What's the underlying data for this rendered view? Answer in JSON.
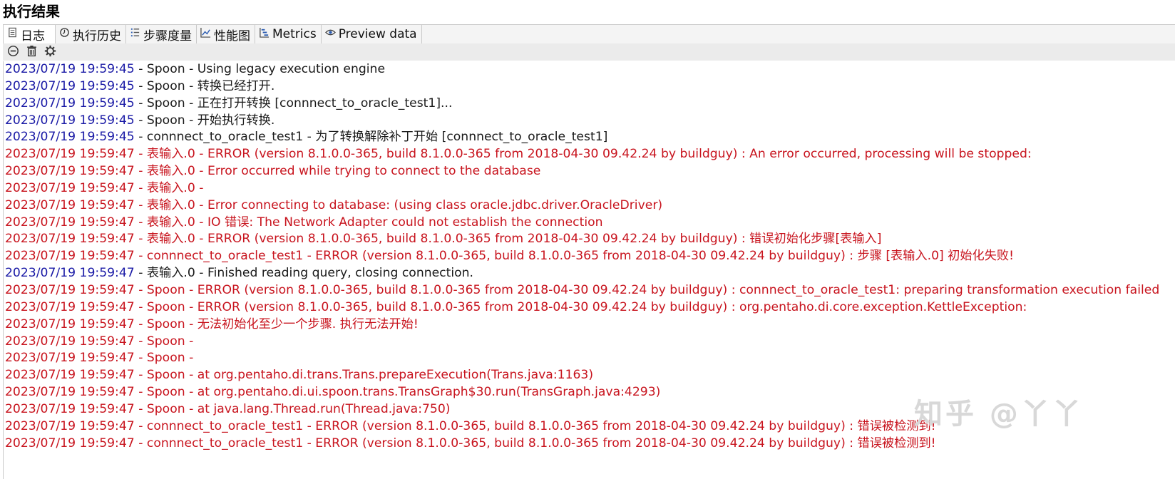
{
  "panel": {
    "title": "执行结果"
  },
  "tabs": [
    {
      "label": "日志",
      "icon": "log-icon",
      "active": true
    },
    {
      "label": "执行历史",
      "icon": "history-icon"
    },
    {
      "label": "步骤度量",
      "icon": "step-metrics-icon"
    },
    {
      "label": "性能图",
      "icon": "performance-chart-icon"
    },
    {
      "label": "Metrics",
      "icon": "metrics-icon"
    },
    {
      "label": "Preview data",
      "icon": "preview-eye-icon"
    }
  ],
  "toolbar": {
    "buttons": [
      {
        "icon": "stop-circle-icon"
      },
      {
        "icon": "trash-icon"
      },
      {
        "icon": "settings-gear-icon"
      }
    ]
  },
  "colors": {
    "timestamp": "#1a1aa6",
    "error": "#c8141e",
    "text": "#1a1a1a"
  },
  "log": [
    {
      "ts": "2023/07/19 19:59:45",
      "msg": " - Spoon - Using legacy execution engine",
      "error": false
    },
    {
      "ts": "2023/07/19 19:59:45",
      "msg": " - Spoon - 转换已经打开.",
      "error": false
    },
    {
      "ts": "2023/07/19 19:59:45",
      "msg": " - Spoon - 正在打开转换 [connnect_to_oracle_test1]...",
      "error": false
    },
    {
      "ts": "2023/07/19 19:59:45",
      "msg": " - Spoon - 开始执行转换.",
      "error": false
    },
    {
      "ts": "2023/07/19 19:59:45",
      "msg": " - connnect_to_oracle_test1 - 为了转换解除补丁开始  [connnect_to_oracle_test1]",
      "error": false
    },
    {
      "ts": "2023/07/19 19:59:47",
      "msg": " - 表输入.0 - ERROR (version 8.1.0.0-365, build 8.1.0.0-365 from 2018-04-30 09.42.24 by buildguy) : An error occurred, processing will be stopped:",
      "error": true
    },
    {
      "ts": "2023/07/19 19:59:47",
      "msg": " - 表输入.0 - Error occurred while trying to connect to the database",
      "error": true
    },
    {
      "ts": "2023/07/19 19:59:47",
      "msg": " - 表输入.0 - ",
      "error": true
    },
    {
      "ts": "2023/07/19 19:59:47",
      "msg": " - 表输入.0 - Error connecting to database: (using class oracle.jdbc.driver.OracleDriver)",
      "error": true
    },
    {
      "ts": "2023/07/19 19:59:47",
      "msg": " - 表输入.0 - IO 错误: The Network Adapter could not establish the connection",
      "error": true
    },
    {
      "ts": "2023/07/19 19:59:47",
      "msg": " - 表输入.0 - ERROR (version 8.1.0.0-365, build 8.1.0.0-365 from 2018-04-30 09.42.24 by buildguy) : 错误初始化步骤[表输入]",
      "error": true
    },
    {
      "ts": "2023/07/19 19:59:47",
      "msg": " - connnect_to_oracle_test1 - ERROR (version 8.1.0.0-365, build 8.1.0.0-365 from 2018-04-30 09.42.24 by buildguy) : 步骤 [表输入.0] 初始化失败!",
      "error": true
    },
    {
      "ts": "2023/07/19 19:59:47",
      "msg": " - 表输入.0 - Finished reading query, closing connection.",
      "error": false
    },
    {
      "ts": "2023/07/19 19:59:47",
      "msg": " - Spoon - ERROR (version 8.1.0.0-365, build 8.1.0.0-365 from 2018-04-30 09.42.24 by buildguy) : connnect_to_oracle_test1: preparing transformation execution failed",
      "error": true
    },
    {
      "ts": "2023/07/19 19:59:47",
      "msg": " - Spoon - ERROR (version 8.1.0.0-365, build 8.1.0.0-365 from 2018-04-30 09.42.24 by buildguy) : org.pentaho.di.core.exception.KettleException:",
      "error": true
    },
    {
      "ts": "2023/07/19 19:59:47",
      "msg": " - Spoon - 无法初始化至少一个步骤.  执行无法开始!",
      "error": true
    },
    {
      "ts": "2023/07/19 19:59:47",
      "msg": " - Spoon - ",
      "error": true
    },
    {
      "ts": "2023/07/19 19:59:47",
      "msg": " - Spoon - ",
      "error": true
    },
    {
      "ts": "2023/07/19 19:59:47",
      "msg": " - Spoon -   at org.pentaho.di.trans.Trans.prepareExecution(Trans.java:1163)",
      "error": true
    },
    {
      "ts": "2023/07/19 19:59:47",
      "msg": " - Spoon -   at org.pentaho.di.ui.spoon.trans.TransGraph$30.run(TransGraph.java:4293)",
      "error": true
    },
    {
      "ts": "2023/07/19 19:59:47",
      "msg": " - Spoon -   at java.lang.Thread.run(Thread.java:750)",
      "error": true
    },
    {
      "ts": "2023/07/19 19:59:47",
      "msg": " - connnect_to_oracle_test1 - ERROR (version 8.1.0.0-365, build 8.1.0.0-365 from 2018-04-30 09.42.24 by buildguy) : 错误被检测到!",
      "error": true
    },
    {
      "ts": "2023/07/19 19:59:47",
      "msg": " - connnect_to_oracle_test1 - ERROR (version 8.1.0.0-365, build 8.1.0.0-365 from 2018-04-30 09.42.24 by buildguy) : 错误被检测到!",
      "error": true
    }
  ],
  "watermark": "知乎 @丫丫"
}
